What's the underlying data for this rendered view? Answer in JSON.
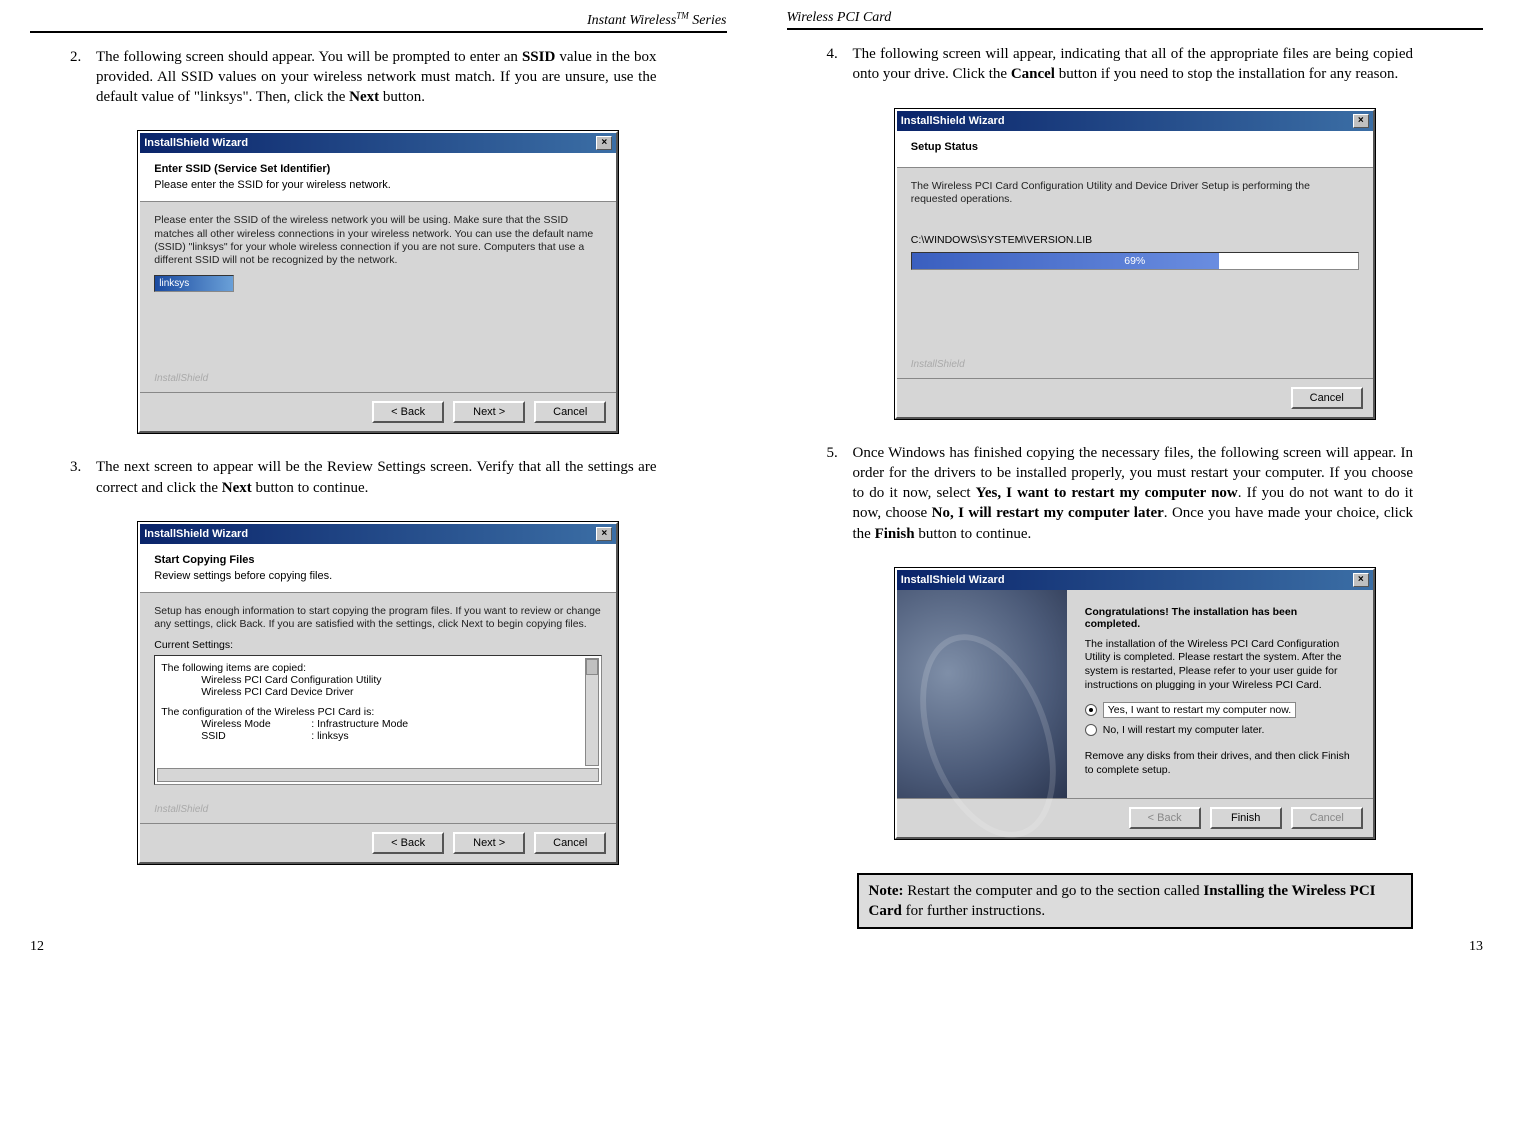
{
  "left": {
    "header": "Instant Wireless™ Series",
    "step2_num": "2.",
    "step2_text_a": "The following screen should appear.  You will be prompted to enter an ",
    "step2_b1": "SSID",
    "step2_text_b": " value in the box provided.   All SSID values on your wireless network must match.  If you are unsure, use the default value of \"linksys\".  Then, click the ",
    "step2_b2": "Next",
    "step2_text_c": " button.",
    "win1": {
      "title": "InstallShield Wizard",
      "head_title": "Enter SSID (Service Set Identifier)",
      "head_sub": "Please enter the SSID for your wireless network.",
      "body": "Please enter the SSID of the wireless network you will be using. Make sure that the SSID matches all other wireless connections in your wireless network. You can use the default name (SSID) \"linksys\" for your whole wireless connection if you are not sure. Computers that use a different SSID will not be recognized by the network.",
      "input": "linksys",
      "brand": "InstallShield",
      "btn_back": "< Back",
      "btn_next": "Next >",
      "btn_cancel": "Cancel"
    },
    "step3_num": "3.",
    "step3_text_a": "The next screen to appear will be the Review Settings screen.  Verify that all the settings are correct and click the ",
    "step3_b1": "Next",
    "step3_text_b": " button to continue.",
    "win2": {
      "title": "InstallShield Wizard",
      "head_title": "Start Copying Files",
      "head_sub": "Review settings before copying files.",
      "intro": "Setup has enough information to start copying the program files.  If you want to review or change any settings, click Back.  If you are satisfied with the settings, click Next to begin copying files.",
      "cur": "Current Settings:",
      "l1": "The following items are copied:",
      "l2": "Wireless PCI Card Configuration Utility",
      "l3": "Wireless PCI Card Device Driver",
      "l4": "The configuration of the Wireless PCI Card is:",
      "l5a": "Wireless Mode",
      "l5b": ": Infrastructure Mode",
      "l6a": "SSID",
      "l6b": ": linksys",
      "brand": "InstallShield",
      "btn_back": "< Back",
      "btn_next": "Next >",
      "btn_cancel": "Cancel"
    },
    "pagenum": "12"
  },
  "right": {
    "header": "Wireless PCI Card",
    "step4_num": "4.",
    "step4_text_a": "The following screen will appear, indicating that all of the appropriate files are being copied onto your drive.  Click the ",
    "step4_b1": "Cancel",
    "step4_text_b": " button if you need to stop the installation for any reason.",
    "win3": {
      "title": "InstallShield Wizard",
      "head_title": "Setup Status",
      "body": "The Wireless PCI Card Configuration Utility and Device Driver Setup is performing the requested operations.",
      "path": "C:\\WINDOWS\\SYSTEM\\VERSION.LIB",
      "pct": "69%",
      "brand": "InstallShield",
      "btn_cancel": "Cancel"
    },
    "step5_num": "5.",
    "step5_text_a": "Once Windows has finished copying the necessary files, the following screen will appear.  In order for the drivers to be installed properly, you must restart your computer.  If you choose to do it now, select ",
    "step5_b1": "Yes, I want to restart my computer now",
    "step5_text_b": ".   If you do not want to do it now, choose ",
    "step5_b2": "No, I will restart my computer later",
    "step5_text_c": ".  Once you have made your choice, click the ",
    "step5_b3": "Finish",
    "step5_text_d": " button to continue.",
    "win4": {
      "title": "InstallShield Wizard",
      "ftitle": "Congratulations! The installation has been completed.",
      "fbody": "The installation of the Wireless PCI Card Configuration Utility is completed. Please restart the system. After the system is restarted, Please refer to your user guide for instructions on plugging in your Wireless PCI Card.",
      "opt1": "Yes, I want to restart my computer now.",
      "opt2": "No, I will restart my computer later.",
      "fnote": "Remove any disks from their drives, and then click Finish to complete setup.",
      "btn_back": "< Back",
      "btn_finish": "Finish",
      "btn_cancel": "Cancel"
    },
    "note_a": "Note:",
    "note_b": "  Restart the computer and go to the section called ",
    "note_c": "Installing the Wireless PCI Card",
    "note_d": " for further instructions.",
    "pagenum": "13"
  }
}
